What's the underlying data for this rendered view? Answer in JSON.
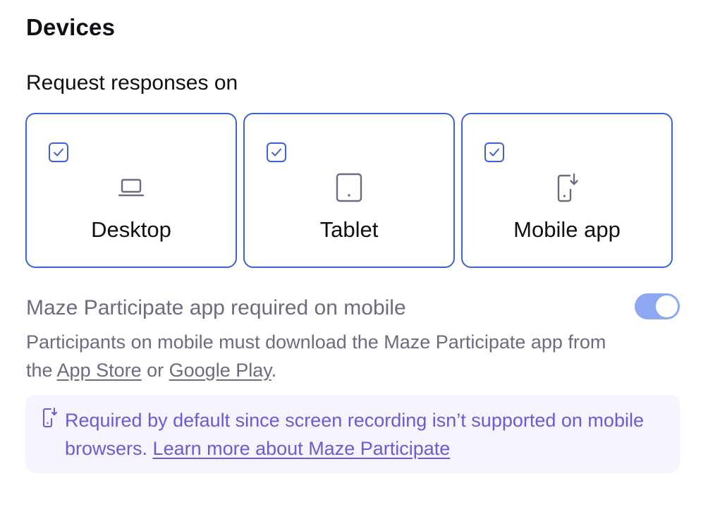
{
  "section": {
    "title": "Devices",
    "subheading": "Request responses on"
  },
  "devices": [
    {
      "label": "Desktop",
      "checked": true,
      "icon": "laptop-icon"
    },
    {
      "label": "Tablet",
      "checked": true,
      "icon": "tablet-icon"
    },
    {
      "label": "Mobile app",
      "checked": true,
      "icon": "mobile-download-icon"
    }
  ],
  "app_required": {
    "title": "Maze Participate app required on mobile",
    "toggle_on": true,
    "desc_prefix": "Participants on mobile must download the Maze Participate app from the ",
    "app_store_link": "App Store",
    "desc_middle": " or ",
    "google_play_link": "Google Play",
    "desc_suffix": "."
  },
  "info": {
    "text": "Required by default since screen recording isn’t supported on mobile browsers. ",
    "link": "Learn more about Maze Participate",
    "icon": "mobile-download-icon"
  },
  "colors": {
    "accent": "#3b63d6",
    "toggle": "#8fa8f3",
    "muted_text": "#6c6c80",
    "info_bg": "#f6f4fe",
    "info_text": "#6c5ad6"
  }
}
